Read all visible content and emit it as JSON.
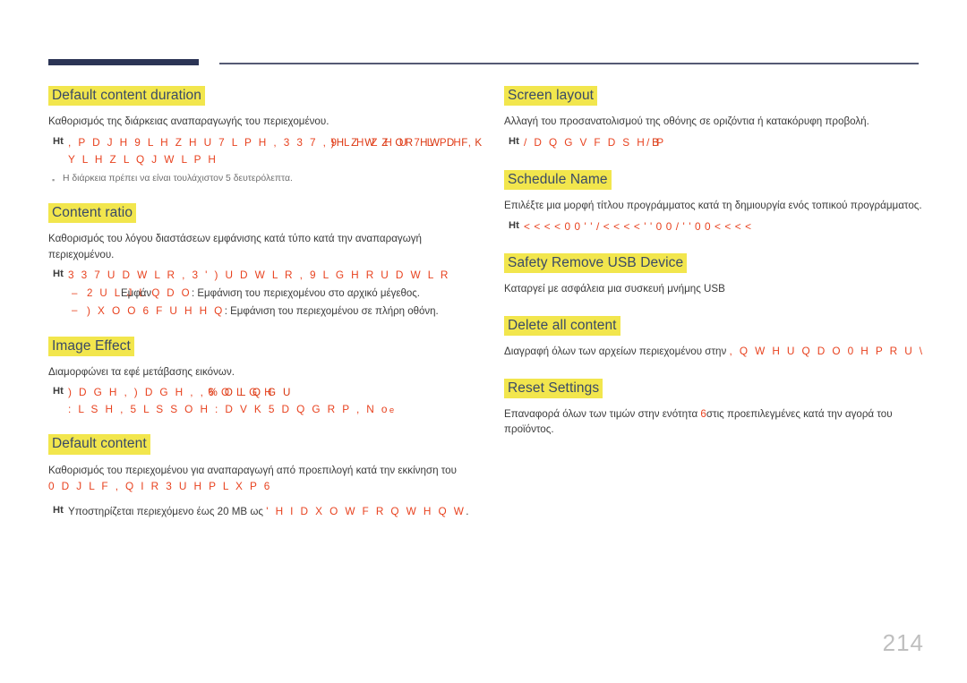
{
  "document": {
    "page_number": "214",
    "language": "el"
  },
  "theme": {
    "rule_thick_color": "#2b3455",
    "rule_thin_color": "#555a74",
    "heading_highlight": "#f2e64d",
    "heading_text": "#3a4a66",
    "option_text": "#e8421f",
    "body_text": "#3b3b3b",
    "page_number_color": "#bfbfbf"
  },
  "note_marker": "Ht",
  "left_column": {
    "sections": [
      {
        "title": "Default content duration",
        "body": "Καθορισμός της διάρκειας αναπαραγωγής του περιεχομένου.",
        "note_options_a": ", P D J H   9 L H Z H U   7 L P H ,  3 3 7 ,",
        "note_options_overlay_base": "9 L H Z H U   7 L P H ,",
        "note_options_overlay_top": ")H Z W Z OR HW D F K",
        "note_options_tail": "Y L H Z L Q J   W L P H",
        "minor_note": "Η διάρκεια πρέπει να είναι τουλάχιστον 5 δευτερόλεπτα."
      },
      {
        "title": "Content ratio",
        "body": "Καθορισμός του λόγου διαστάσεων εμφάνισης κατά τύπο κατά την αναπαραγωγή περιεχομένου.",
        "note_options": "3 3 7   U D W L R ,   3 ' )   U D W L R ,   9 L G H R   U D W L R",
        "sublist": [
          {
            "option_base": "2 U L J L Q D O",
            "option_overlay": "Εμφάν",
            "text": ": Εμφάνιση του περιεχομένου στο αρχικό μέγεθος."
          },
          {
            "option_base": ") X O O   6 F U H H Q",
            "option_overlay": "",
            "text": ": Εμφάνιση του περιεχομένου σε πλήρη οθόνη."
          }
        ]
      },
      {
        "title": "Image Effect",
        "body": "Διαμορφώνει τα εφέ μετάβασης εικόνων.",
        "note_options_head": ") D G H  ,  ) D G H  , ,",
        "note_options_overlay_base": "6 O L G H",
        "note_options_overlay_top": "% O L Q G U",
        "note_options_mid": ": L S H ,   5 L S S O H   : D V K   5 D Q G R P ,   N o",
        "note_options_tail_small": "e"
      },
      {
        "title": "Default content",
        "body": "Καθορισμός του περιεχομένου για αναπαραγωγή από προεπιλογή κατά την εκκίνηση του",
        "body_option_line": "0 D J L F , Q I R   3 U H P L X P   6",
        "note_prefix": "Υποστηρίζεται περιεχόμενο έως 20 MB ως",
        "note_option": "' H I D X O W   F R Q W H Q W",
        "note_suffix": "."
      }
    ]
  },
  "right_column": {
    "sections": [
      {
        "title": "Screen layout",
        "body": "Αλλαγή του προσανατολισμού της οθόνης σε οριζόντια ή κατακόρυφη προβολή.",
        "note_options_base": "/ D Q G V F D S H",
        "note_options_overlay": "/ P",
        "note_options_tail": "B"
      },
      {
        "title": "Schedule Name",
        "body": "Επιλέξτε μια μορφή τίτλου προγράμματος κατά τη δημιουργία ενός τοπικού προγράμματος.",
        "note_options": "< < < < 0 0 ' ' /  < < < < ' ' 0 0 /  ' ' 0 0 < < < <"
      },
      {
        "title": "Safety Remove USB Device",
        "body": "Καταργεί με ασφάλεια μια συσκευή μνήμης USB"
      },
      {
        "title": "Delete all content",
        "body_prefix": "Διαγραφή όλων των αρχείων περιεχομένου στην",
        "body_option": ", Q W H U Q D O   0 H P R U \\"
      },
      {
        "title": "Reset Settings",
        "body_part1": "Επαναφορά όλων των τιμών στην ενότητα",
        "body_overlay_glyph": "6",
        "body_part2": "στις προεπιλεγμένες κατά την αγορά του προϊόντος."
      }
    ]
  }
}
